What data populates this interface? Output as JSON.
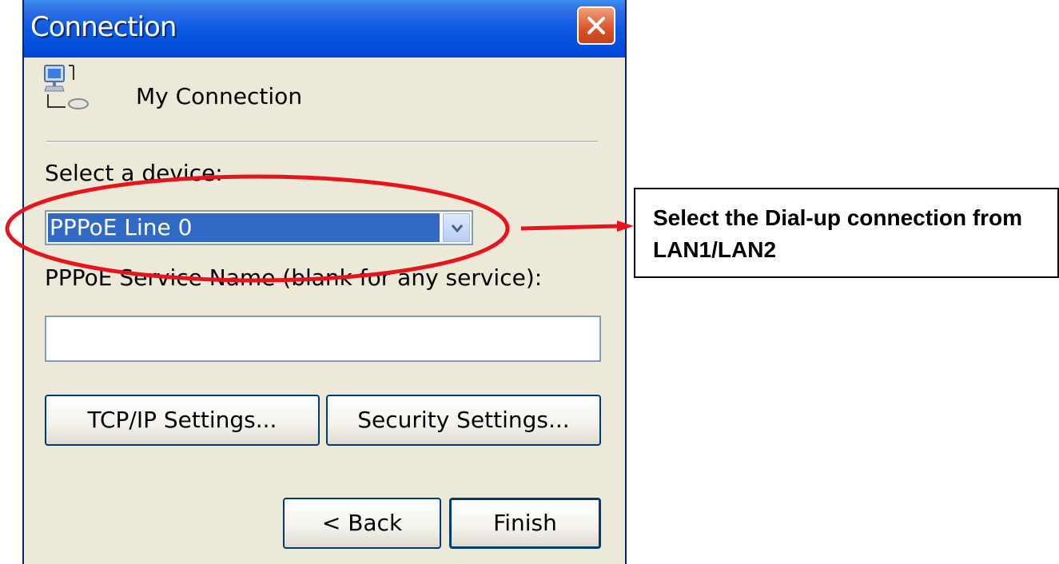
{
  "dialog": {
    "title": "Connection",
    "connection_name": "My Connection",
    "device_label": "Select a device:",
    "device_value": "PPPoE Line 0",
    "service_label": "PPPoE Service Name (blank for any service):",
    "service_value": "",
    "tcpip_button": "TCP/IP Settings...",
    "security_button": "Security Settings...",
    "back_button": "< Back",
    "finish_button": "Finish"
  },
  "annotation": {
    "callout_text": "Select the Dial-up connection from LAN1/LAN2",
    "highlight_color": "#e8141c"
  },
  "colors": {
    "titlebar": "#0a58e1",
    "selection": "#316ac5",
    "dialog_bg": "#ece9d8"
  },
  "icons": [
    "close-icon",
    "network-connection-icon",
    "chevron-down-icon",
    "arrow-icon"
  ]
}
